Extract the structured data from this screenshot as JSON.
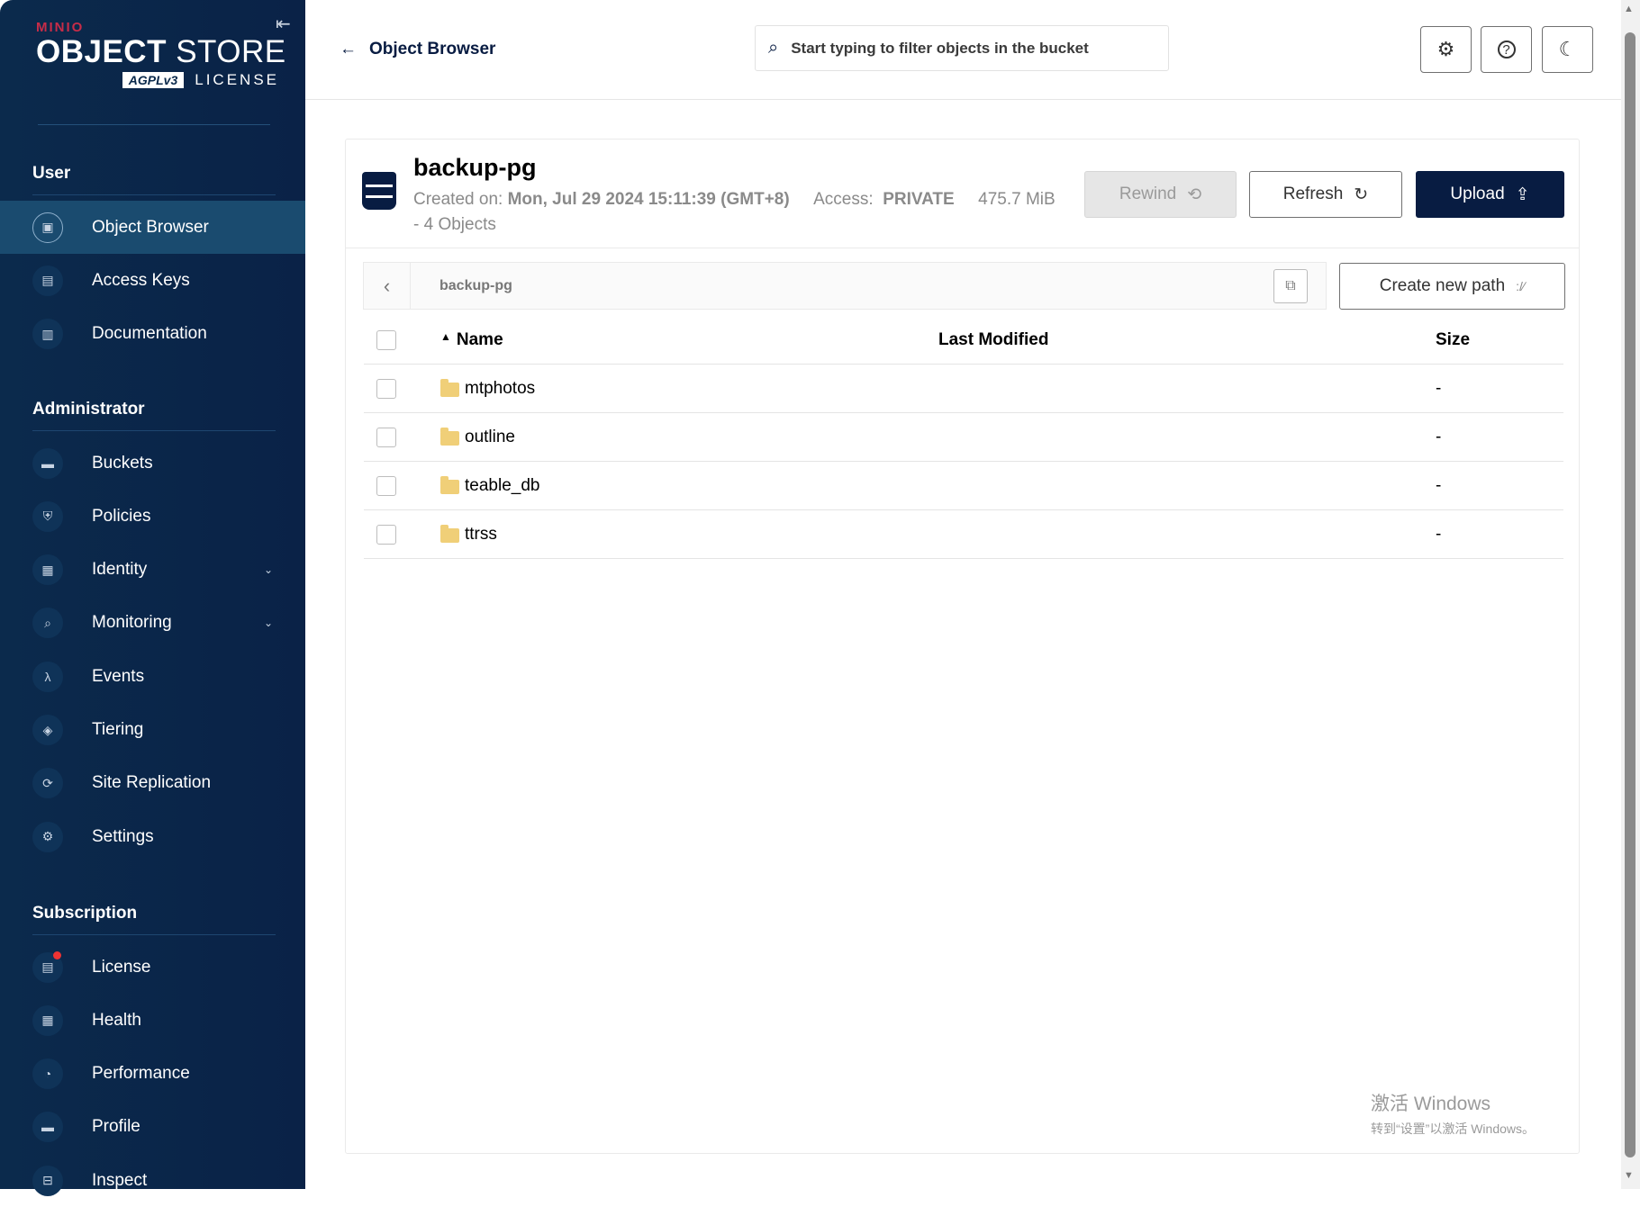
{
  "logo": {
    "brand": "MINIO",
    "product_bold": "OBJECT",
    "product_light": "STORE",
    "license_badge": "AGPLv3",
    "license": "LICENSE"
  },
  "sidebar": {
    "sections": [
      {
        "title": "User",
        "items": [
          {
            "label": "Object Browser",
            "icon": "object-browser-icon",
            "active": true
          },
          {
            "label": "Access Keys",
            "icon": "key-icon"
          },
          {
            "label": "Documentation",
            "icon": "document-icon"
          }
        ]
      },
      {
        "title": "Administrator",
        "items": [
          {
            "label": "Buckets",
            "icon": "bucket-icon"
          },
          {
            "label": "Policies",
            "icon": "shield-icon"
          },
          {
            "label": "Identity",
            "icon": "id-card-icon",
            "expandable": true
          },
          {
            "label": "Monitoring",
            "icon": "search-chart-icon",
            "expandable": true
          },
          {
            "label": "Events",
            "icon": "lambda-icon"
          },
          {
            "label": "Tiering",
            "icon": "layers-icon"
          },
          {
            "label": "Site Replication",
            "icon": "replication-icon"
          },
          {
            "label": "Settings",
            "icon": "gear-icon"
          }
        ]
      },
      {
        "title": "Subscription",
        "items": [
          {
            "label": "License",
            "icon": "license-icon",
            "badge": true
          },
          {
            "label": "Health",
            "icon": "health-icon"
          },
          {
            "label": "Performance",
            "icon": "gauge-icon"
          },
          {
            "label": "Profile",
            "icon": "profile-icon"
          },
          {
            "label": "Inspect",
            "icon": "inspect-icon"
          }
        ]
      }
    ]
  },
  "header": {
    "back_label": "Object Browser",
    "search_placeholder": "Start typing to filter objects in the bucket"
  },
  "bucket": {
    "name": "backup-pg",
    "created_label": "Created on:",
    "created_value": "Mon, Jul 29 2024 15:11:39 (GMT+8)",
    "access_label": "Access:",
    "access_value": "PRIVATE",
    "size": "475.7 MiB",
    "objects": "- 4 Objects"
  },
  "buttons": {
    "rewind": "Rewind",
    "refresh": "Refresh",
    "upload": "Upload",
    "create_path": "Create new path"
  },
  "breadcrumb": {
    "path": "backup-pg"
  },
  "table": {
    "columns": {
      "name": "Name",
      "modified": "Last Modified",
      "size": "Size"
    },
    "rows": [
      {
        "name": "mtphotos",
        "modified": "",
        "size": "-"
      },
      {
        "name": "outline",
        "modified": "",
        "size": "-"
      },
      {
        "name": "teable_db",
        "modified": "",
        "size": "-"
      },
      {
        "name": "ttrss",
        "modified": "",
        "size": "-"
      }
    ]
  },
  "watermark": {
    "line1": "激活 Windows",
    "line2": "转到“设置”以激活 Windows。"
  },
  "colors": {
    "sidebar": "#0b2a4c",
    "primary": "#081c42",
    "accent": "#c72c48"
  }
}
